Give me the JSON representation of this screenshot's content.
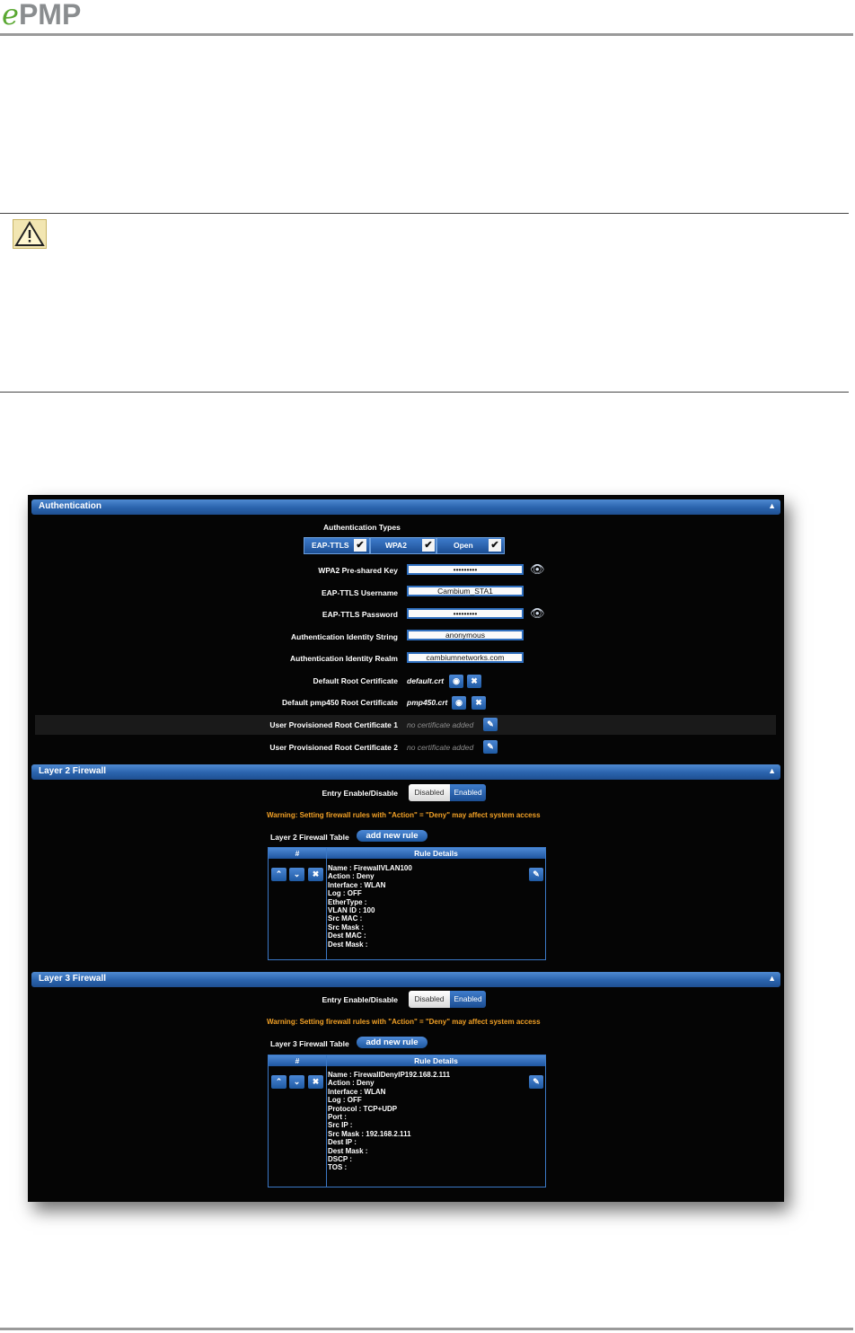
{
  "brand": {
    "logo_e": "e",
    "logo_pmp": "PMP"
  },
  "colors": {
    "accent_blue": "#2a63ad",
    "warning_orange": "#f2a126",
    "brand_green": "#5aa832"
  },
  "authentication": {
    "title": "Authentication",
    "types_label": "Authentication Types",
    "types": [
      {
        "label": "EAP-TTLS",
        "checked": true
      },
      {
        "label": "WPA2",
        "checked": true
      },
      {
        "label": "Open",
        "checked": true
      }
    ],
    "fields": [
      {
        "label": "WPA2 Pre-shared Key",
        "value": "•••••••••",
        "has_eye": true
      },
      {
        "label": "EAP-TTLS Username",
        "value": "Cambium_STA1",
        "has_eye": false
      },
      {
        "label": "EAP-TTLS Password",
        "value": "•••••••••",
        "has_eye": true
      },
      {
        "label": "Authentication Identity String",
        "value": "anonymous",
        "has_eye": false
      },
      {
        "label": "Authentication Identity Realm",
        "value": "cambiumnetworks.com",
        "has_eye": false
      }
    ],
    "certs": [
      {
        "label": "Default Root Certificate",
        "value": "default.crt"
      },
      {
        "label": "Default pmp450 Root Certificate",
        "value": "pmp450.crt"
      },
      {
        "label": "User Provisioned Root Certificate 1",
        "value": "no certificate added"
      },
      {
        "label": "User Provisioned Root Certificate 2",
        "value": "no certificate added"
      }
    ]
  },
  "layer2": {
    "title": "Layer 2 Firewall",
    "entry_label": "Entry Enable/Disable",
    "toggle_off": "Disabled",
    "toggle_on": "Enabled",
    "warning": "Warning: Setting firewall rules with \"Action\" = \"Deny\" may affect system access",
    "table_label": "Layer 2 Firewall Table",
    "add_label": "add new rule",
    "col_num": "#",
    "col_details": "Rule Details",
    "rule_details": "Name : FirewallVLAN100\nAction : Deny\nInterface : WLAN\nLog : OFF\nEtherType :\nVLAN ID : 100\nSrc MAC :\nSrc Mask :\nDest MAC :\nDest Mask :"
  },
  "layer3": {
    "title": "Layer 3 Firewall",
    "entry_label": "Entry Enable/Disable",
    "toggle_off": "Disabled",
    "toggle_on": "Enabled",
    "warning": "Warning: Setting firewall rules with \"Action\" = \"Deny\" may affect system access",
    "table_label": "Layer 3 Firewall Table",
    "add_label": "add new rule",
    "col_num": "#",
    "col_details": "Rule Details",
    "rule_details": "Name : FirewallDenyIP192.168.2.111\nAction : Deny\nInterface : WLAN\nLog : OFF\nProtocol : TCP+UDP\nPort :\nSrc IP :\nSrc Mask : 192.168.2.111\nDest IP :\nDest Mask :\nDSCP :\nTOS :"
  }
}
